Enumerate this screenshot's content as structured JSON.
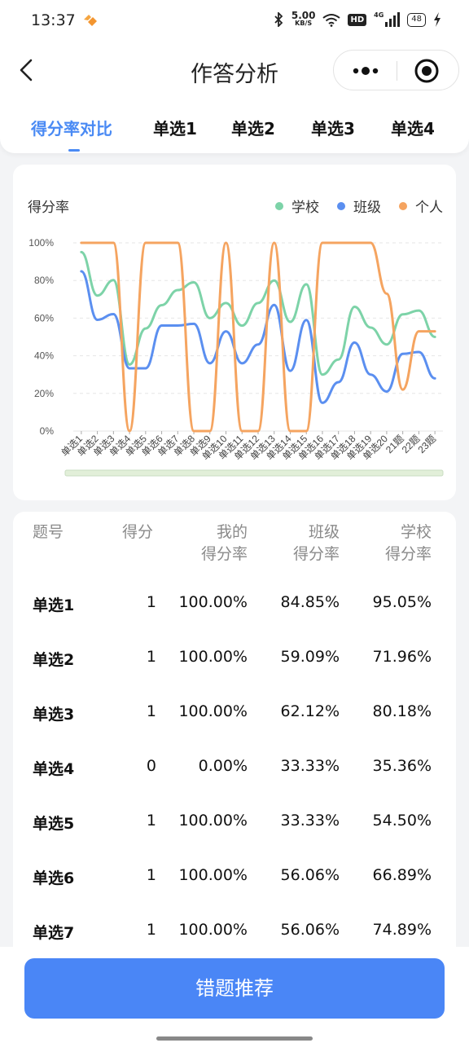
{
  "status_bar": {
    "time": "13:37",
    "net_speed_value": "5.00",
    "net_speed_unit": "KB/S",
    "hd_label": "HD",
    "signal_label": "4G",
    "battery": "48"
  },
  "header": {
    "title": "作答分析"
  },
  "tabs": [
    {
      "label": "得分率对比",
      "active": true
    },
    {
      "label": "单选1"
    },
    {
      "label": "单选2"
    },
    {
      "label": "单选3"
    },
    {
      "label": "单选4"
    }
  ],
  "chart": {
    "ylabel": "得分率",
    "legend": [
      {
        "label": "学校",
        "color": "#7dd3a8"
      },
      {
        "label": "班级",
        "color": "#5b8ff0"
      },
      {
        "label": "个人",
        "color": "#f5a460"
      }
    ]
  },
  "chart_data": {
    "type": "line",
    "x": [
      "单选1",
      "单选2",
      "单选3",
      "单选4",
      "单选5",
      "单选6",
      "单选7",
      "单选8",
      "单选9",
      "单选10",
      "单选11",
      "单选12",
      "单选13",
      "单选14",
      "单选15",
      "单选16",
      "单选17",
      "单选18",
      "单选19",
      "单选20",
      "21题",
      "22题",
      "23题"
    ],
    "ylim": [
      0,
      100
    ],
    "yticks": [
      "0%",
      "20%",
      "40%",
      "60%",
      "80%",
      "100%"
    ],
    "series": [
      {
        "name": "学校",
        "color": "#7dd3a8",
        "values": [
          95.05,
          71.96,
          80.18,
          35.36,
          54.5,
          66.89,
          74.89,
          79,
          60,
          68,
          56,
          68,
          80,
          58,
          78,
          30,
          38,
          66,
          55,
          46,
          62,
          64,
          50
        ]
      },
      {
        "name": "班级",
        "color": "#5b8ff0",
        "values": [
          84.85,
          59.09,
          62.12,
          33.33,
          33.33,
          56.06,
          56.06,
          57,
          36,
          53,
          36,
          46,
          67,
          32,
          59,
          15,
          26,
          47,
          30,
          21,
          41,
          42,
          28
        ]
      },
      {
        "name": "个人",
        "color": "#f5a460",
        "values": [
          100,
          100,
          100,
          0,
          100,
          100,
          100,
          0,
          0,
          100,
          0,
          0,
          100,
          0,
          0,
          100,
          100,
          100,
          100,
          73,
          22,
          53,
          53
        ]
      }
    ],
    "grid": true,
    "legend_position": "top-right"
  },
  "table": {
    "headers": [
      {
        "line1": "题号",
        "line2": ""
      },
      {
        "line1": "得分",
        "line2": ""
      },
      {
        "line1": "我的",
        "line2": "得分率"
      },
      {
        "line1": "班级",
        "line2": "得分率"
      },
      {
        "line1": "学校",
        "line2": "得分率"
      }
    ],
    "rows": [
      {
        "q": "单选1",
        "score": "1",
        "mine": "100.00%",
        "cls": "84.85%",
        "school": "95.05%"
      },
      {
        "q": "单选2",
        "score": "1",
        "mine": "100.00%",
        "cls": "59.09%",
        "school": "71.96%"
      },
      {
        "q": "单选3",
        "score": "1",
        "mine": "100.00%",
        "cls": "62.12%",
        "school": "80.18%"
      },
      {
        "q": "单选4",
        "score": "0",
        "mine": "0.00%",
        "cls": "33.33%",
        "school": "35.36%"
      },
      {
        "q": "单选5",
        "score": "1",
        "mine": "100.00%",
        "cls": "33.33%",
        "school": "54.50%"
      },
      {
        "q": "单选6",
        "score": "1",
        "mine": "100.00%",
        "cls": "56.06%",
        "school": "66.89%"
      },
      {
        "q": "单选7",
        "score": "1",
        "mine": "100.00%",
        "cls": "56.06%",
        "school": "74.89%"
      }
    ]
  },
  "footer": {
    "button_label": "错题推荐"
  }
}
